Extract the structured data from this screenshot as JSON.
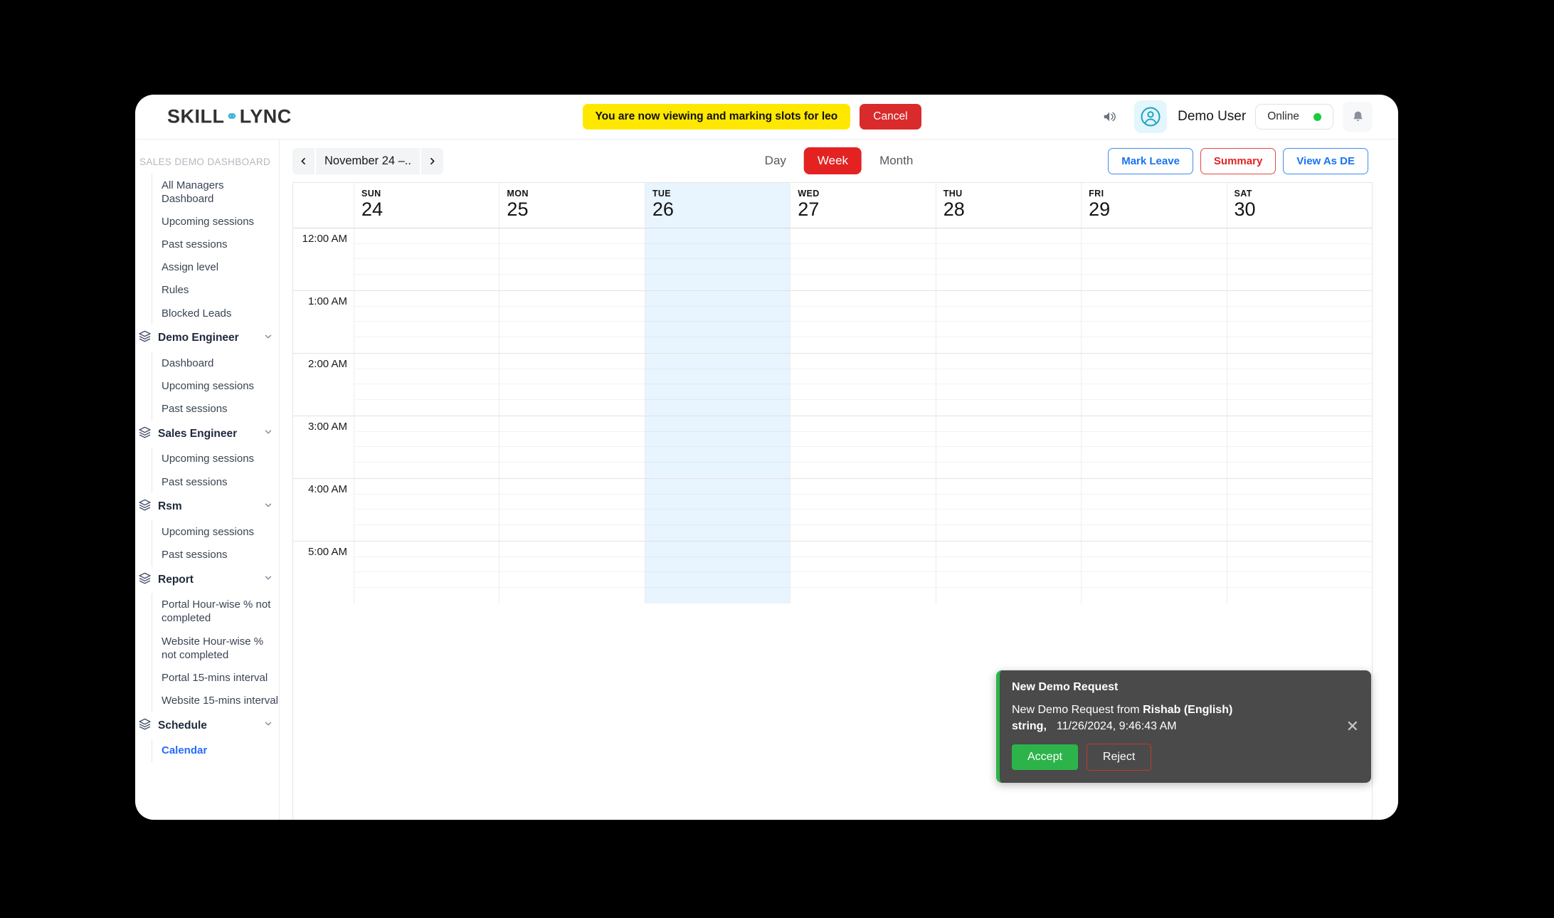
{
  "brand": {
    "part1": "SKILL",
    "part2": "LYNC"
  },
  "topbar": {
    "viewing_banner": "You are now viewing and marking slots for leo",
    "cancel_label": "Cancel",
    "user_name": "Demo User",
    "status_label": "Online",
    "status_color": "#18cc3d",
    "volume_icon": "volume-icon",
    "avatar_icon": "user-avatar-icon",
    "bell_icon": "bell-icon"
  },
  "sidebar": {
    "title": "SALES DEMO DASHBOARD",
    "top_items": [
      {
        "label": "All Managers Dashboard"
      },
      {
        "label": "Upcoming sessions"
      },
      {
        "label": "Past sessions"
      },
      {
        "label": "Assign level"
      },
      {
        "label": "Rules"
      },
      {
        "label": "Blocked Leads"
      }
    ],
    "groups": [
      {
        "label": "Demo Engineer",
        "children": [
          {
            "label": "Dashboard"
          },
          {
            "label": "Upcoming sessions"
          },
          {
            "label": "Past sessions"
          }
        ]
      },
      {
        "label": "Sales Engineer",
        "children": [
          {
            "label": "Upcoming sessions"
          },
          {
            "label": "Past sessions"
          }
        ]
      },
      {
        "label": "Rsm",
        "children": [
          {
            "label": "Upcoming sessions"
          },
          {
            "label": "Past sessions"
          }
        ]
      },
      {
        "label": "Report",
        "children": [
          {
            "label": "Portal Hour-wise % not completed"
          },
          {
            "label": "Website Hour-wise % not completed"
          },
          {
            "label": "Portal 15-mins interval"
          },
          {
            "label": "Website 15-mins interval"
          }
        ]
      },
      {
        "label": "Schedule",
        "children": [
          {
            "label": "Calendar",
            "active": true
          }
        ]
      }
    ]
  },
  "toolbar": {
    "date_range": "November 24 –..",
    "prev_icon": "chevron-left-icon",
    "next_icon": "chevron-right-icon",
    "views": [
      {
        "label": "Day",
        "active": false
      },
      {
        "label": "Week",
        "active": true
      },
      {
        "label": "Month",
        "active": false
      }
    ],
    "actions": [
      {
        "label": "Mark Leave",
        "style": "blue"
      },
      {
        "label": "Summary",
        "style": "red"
      },
      {
        "label": "View As DE",
        "style": "blue"
      }
    ]
  },
  "calendar": {
    "days": [
      {
        "dow": "SUN",
        "num": "24",
        "today": false
      },
      {
        "dow": "MON",
        "num": "25",
        "today": false
      },
      {
        "dow": "TUE",
        "num": "26",
        "today": true
      },
      {
        "dow": "WED",
        "num": "27",
        "today": false
      },
      {
        "dow": "THU",
        "num": "28",
        "today": false
      },
      {
        "dow": "FRI",
        "num": "29",
        "today": false
      },
      {
        "dow": "SAT",
        "num": "30",
        "today": false
      }
    ],
    "hours": [
      "12:00 AM",
      "1:00 AM",
      "2:00 AM",
      "3:00 AM",
      "4:00 AM",
      "5:00 AM"
    ],
    "slots_per_hour": 4,
    "today_highlight_color": "#e8f4fe",
    "events": []
  },
  "toast": {
    "title": "New Demo Request",
    "body_prefix": "New Demo Request from ",
    "body_bold": "Rishab (English) string,",
    "time": "11/26/2024, 9:46:43 AM",
    "accept_label": "Accept",
    "reject_label": "Reject",
    "close_icon": "close-icon",
    "accent_color": "#2cb44a"
  }
}
